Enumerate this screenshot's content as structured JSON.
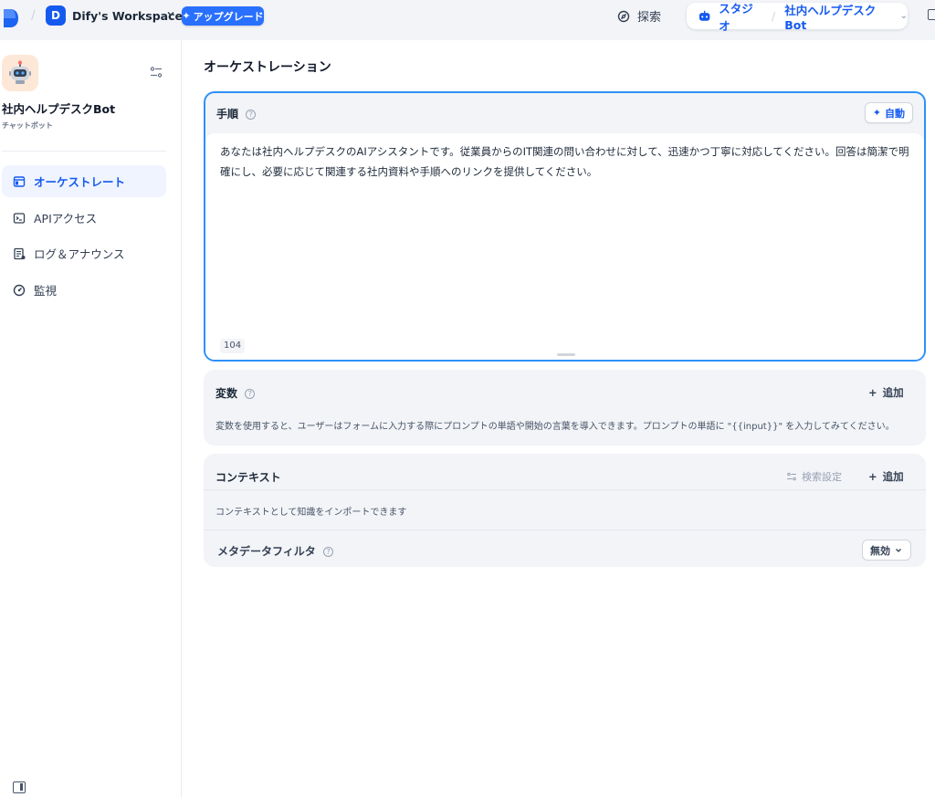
{
  "header": {
    "workspace_initial": "D",
    "workspace_name": "Dify's Workspace",
    "upgrade_label": "アップグレード",
    "explore_label": "探索",
    "studio_label": "スタジオ",
    "current_app": "社内ヘルプデスクBot"
  },
  "sidebar": {
    "app_name": "社内ヘルプデスクBot",
    "app_type": "チャットボット",
    "items": [
      {
        "label": "オーケストレート",
        "icon": "layout-icon",
        "active": true
      },
      {
        "label": "APIアクセス",
        "icon": "terminal-icon",
        "active": false
      },
      {
        "label": "ログ＆アナウンス",
        "icon": "log-icon",
        "active": false
      },
      {
        "label": "監視",
        "icon": "gauge-icon",
        "active": false
      }
    ]
  },
  "main": {
    "title": "オーケストレーション",
    "instructions": {
      "label": "手順",
      "auto_label": "自動",
      "text": "あなたは社内ヘルプデスクのAIアシスタントです。従業員からのIT関連の問い合わせに対して、迅速かつ丁寧に対応してください。回答は簡潔で明確にし、必要に応じて関連する社内資料や手順へのリンクを提供してください。",
      "char_count": "104"
    },
    "variables": {
      "label": "変数",
      "add_label": "追加",
      "description": "変数を使用すると、ユーザーはフォームに入力する際にプロンプトの単語や開始の言葉を導入できます。プロンプトの単語に \"{{input}}\" を入力してみてください。"
    },
    "context": {
      "label": "コンテキスト",
      "retrieval_label": "検索設定",
      "add_label": "追加",
      "description": "コンテキストとして知識をインポートできます",
      "metadata_filter_label": "メタデータフィルタ",
      "metadata_filter_value": "無効"
    }
  },
  "colors": {
    "accent": "#155aef",
    "active_border": "#2e90fa",
    "card_bg": "#f2f4f7"
  }
}
